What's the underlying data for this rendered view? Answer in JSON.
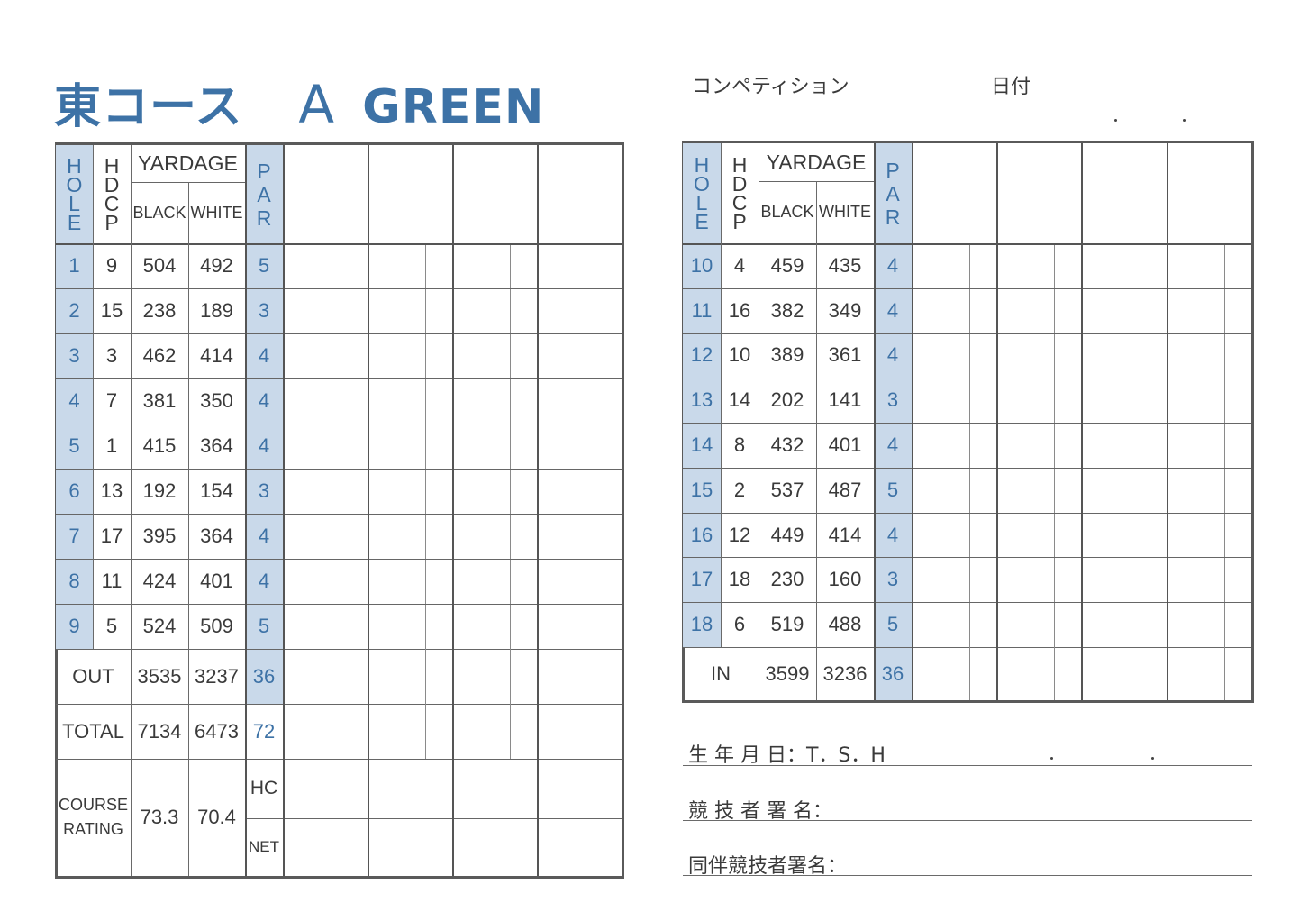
{
  "header": {
    "course_name": "東コース",
    "course_letter": "A",
    "course_color": "GREEN",
    "competition_label": "コンペティション",
    "date_label": "日付"
  },
  "colors": {
    "accent_blue": "#3d72a6",
    "shade_blue": "#c9d9ea",
    "border": "#5a5a5a"
  },
  "columns": {
    "hole": [
      "H",
      "O",
      "L",
      "E"
    ],
    "hdcp": [
      "H",
      "D",
      "C",
      "P"
    ],
    "yardage": "YARDAGE",
    "black": "BLACK",
    "white": "WHITE",
    "par": [
      "P",
      "A",
      "R"
    ]
  },
  "front_nine": [
    {
      "hole": "1",
      "hdcp": "9",
      "black": "504",
      "white": "492",
      "par": "5"
    },
    {
      "hole": "2",
      "hdcp": "15",
      "black": "238",
      "white": "189",
      "par": "3"
    },
    {
      "hole": "3",
      "hdcp": "3",
      "black": "462",
      "white": "414",
      "par": "4"
    },
    {
      "hole": "4",
      "hdcp": "7",
      "black": "381",
      "white": "350",
      "par": "4"
    },
    {
      "hole": "5",
      "hdcp": "1",
      "black": "415",
      "white": "364",
      "par": "4"
    },
    {
      "hole": "6",
      "hdcp": "13",
      "black": "192",
      "white": "154",
      "par": "3"
    },
    {
      "hole": "7",
      "hdcp": "17",
      "black": "395",
      "white": "364",
      "par": "4"
    },
    {
      "hole": "8",
      "hdcp": "11",
      "black": "424",
      "white": "401",
      "par": "4"
    },
    {
      "hole": "9",
      "hdcp": "5",
      "black": "524",
      "white": "509",
      "par": "5"
    }
  ],
  "out_row": {
    "label": "OUT",
    "black": "3535",
    "white": "3237",
    "par": "36"
  },
  "total_row": {
    "label": "TOTAL",
    "black": "7134",
    "white": "6473",
    "par": "72"
  },
  "course_rating": {
    "label_line1": "COURSE",
    "label_line2": "RATING",
    "black": "73.3",
    "white": "70.4",
    "hc_label": "HC",
    "net_label": "NET"
  },
  "back_nine": [
    {
      "hole": "10",
      "hdcp": "4",
      "black": "459",
      "white": "435",
      "par": "4"
    },
    {
      "hole": "11",
      "hdcp": "16",
      "black": "382",
      "white": "349",
      "par": "4"
    },
    {
      "hole": "12",
      "hdcp": "10",
      "black": "389",
      "white": "361",
      "par": "4"
    },
    {
      "hole": "13",
      "hdcp": "14",
      "black": "202",
      "white": "141",
      "par": "3"
    },
    {
      "hole": "14",
      "hdcp": "8",
      "black": "432",
      "white": "401",
      "par": "4"
    },
    {
      "hole": "15",
      "hdcp": "2",
      "black": "537",
      "white": "487",
      "par": "5"
    },
    {
      "hole": "16",
      "hdcp": "12",
      "black": "449",
      "white": "414",
      "par": "4"
    },
    {
      "hole": "17",
      "hdcp": "18",
      "black": "230",
      "white": "160",
      "par": "3"
    },
    {
      "hole": "18",
      "hdcp": "6",
      "black": "519",
      "white": "488",
      "par": "5"
    }
  ],
  "in_row": {
    "label": "IN",
    "black": "3599",
    "white": "3236",
    "par": "36"
  },
  "signature": {
    "birthdate_label": "生 年 月 日：T．S．H",
    "player_sign_label": "競 技 者 署 名：",
    "partner_sign_label": "同伴競技者署名："
  }
}
